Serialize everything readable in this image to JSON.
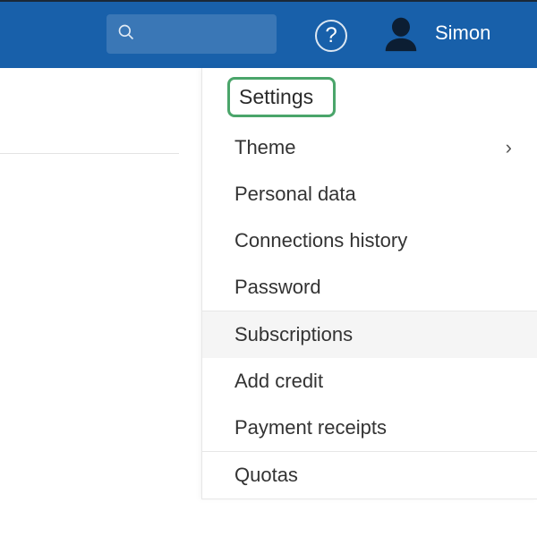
{
  "header": {
    "search_placeholder": "",
    "help_label": "?",
    "username": "Simon"
  },
  "menu": {
    "sections": [
      {
        "items": [
          {
            "label": "Settings",
            "highlighted_box": true
          },
          {
            "label": "Theme",
            "has_submenu": true
          },
          {
            "label": "Personal data"
          },
          {
            "label": "Connections history"
          },
          {
            "label": "Password"
          }
        ]
      },
      {
        "items": [
          {
            "label": "Subscriptions",
            "highlighted_row": true
          },
          {
            "label": "Add credit"
          },
          {
            "label": "Payment receipts"
          }
        ]
      },
      {
        "items": [
          {
            "label": "Quotas"
          }
        ]
      }
    ]
  }
}
